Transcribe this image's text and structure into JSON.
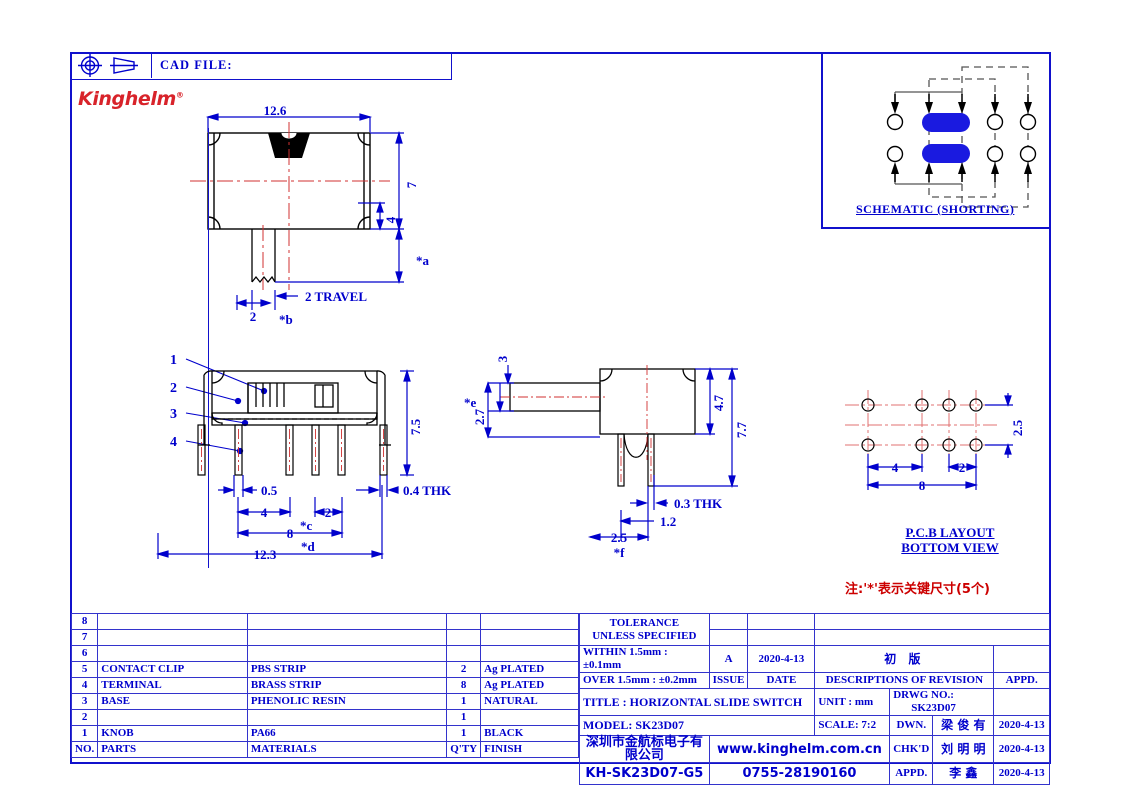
{
  "header": {
    "cad_file_label": "CAD FILE:",
    "brand": "Kinghelm",
    "brand_sup": "®"
  },
  "schematic": {
    "caption": "SCHEMATIC (SHORTING)"
  },
  "pcb": {
    "caption_line1": "P.C.B  LAYOUT",
    "caption_line2": "BOTTOM  VIEW",
    "dims": {
      "pitch_a": "4",
      "pitch_b": "2",
      "total": "8",
      "row_gap": "2.5"
    }
  },
  "note": "注:'*'表示关键尺寸(5个)",
  "views": {
    "top": {
      "width": "12.6",
      "height": "7",
      "knob_offset": "4",
      "travel": "2  TRAVEL",
      "travel_width": "2",
      "star_a": "*a",
      "star_b": "*b"
    },
    "front": {
      "callouts": [
        "1",
        "2",
        "3",
        "4"
      ],
      "height": "7.5",
      "thickness": "0.4  THK",
      "lead_gap": "0.5",
      "pitch_a": "4",
      "pitch_b": "2",
      "span8": "8",
      "span123": "12.3",
      "star_c": "*c",
      "star_d": "*d"
    },
    "side": {
      "knob_h": "3",
      "knob_y": "2.7",
      "body_h": "4.7",
      "total_h": "7.7",
      "pin_thk": "0.3  THK",
      "pin_w": "1.2",
      "pin_pitch": "2.5",
      "star_e": "*e",
      "star_f": "*f"
    }
  },
  "parts_table": {
    "columns": [
      "NO.",
      "PARTS",
      "MATERIALS",
      "Q'TY",
      "FINISH"
    ],
    "rows": [
      {
        "no": "8",
        "parts": "",
        "materials": "",
        "qty": "",
        "finish": ""
      },
      {
        "no": "7",
        "parts": "",
        "materials": "",
        "qty": "",
        "finish": ""
      },
      {
        "no": "6",
        "parts": "",
        "materials": "",
        "qty": "",
        "finish": ""
      },
      {
        "no": "5",
        "parts": "CONTACT CLIP",
        "materials": "PBS STRIP",
        "qty": "2",
        "finish": "Ag PLATED"
      },
      {
        "no": "4",
        "parts": "TERMINAL",
        "materials": "BRASS STRIP",
        "qty": "8",
        "finish": "Ag PLATED"
      },
      {
        "no": "3",
        "parts": "BASE",
        "materials": "PHENOLIC RESIN",
        "qty": "1",
        "finish": "NATURAL"
      },
      {
        "no": "2",
        "parts": "",
        "materials": "",
        "qty": "1",
        "finish": ""
      },
      {
        "no": "1",
        "parts": "KNOB",
        "materials": "PA66",
        "qty": "1",
        "finish": "BLACK"
      }
    ]
  },
  "title_block": {
    "tolerance_line1": "TOLERANCE",
    "tolerance_line2": "UNLESS   SPECIFIED",
    "tol_within": "WITHIN 1.5mm : ±0.1mm",
    "tol_over": "OVER 1.5mm : ±0.2mm",
    "issue_value": "A",
    "issue_label": "ISSUE",
    "date_value": "2020-4-13",
    "date_label": "DATE",
    "revision_value": "初 版",
    "revision_label": "DESCRIPTIONS OF REVISION",
    "appd_col_label": "APPD.",
    "title_label": "TITLE :   HORIZONTAL SLIDE SWITCH",
    "model_label": "MODEL:   SK23D07",
    "unit_label": "UNIT :    mm",
    "scale_label": "SCALE:   7:2",
    "drwg_no_label": "DRWG NO.:",
    "drwg_no_value": "SK23D07",
    "dwn_label": "DWN.",
    "dwn_name": "梁 俊 有",
    "dwn_date": "2020-4-13",
    "chkd_label": "CHK'D",
    "chkd_name": "刘 明 明",
    "chkd_date": "2020-4-13",
    "appd_label": "APPD.",
    "appd_name": "李 鑫",
    "appd_date": "2020-4-13",
    "company_cn": "深圳市金航标电子有限公司",
    "website": "www.kinghelm.com.cn",
    "part_number": "KH-SK23D07-G5",
    "phone": "0755-28190160"
  },
  "colors": {
    "line_blue": "#0000cc",
    "frame_blue": "#1111cc",
    "logo_red": "#d8232a",
    "center_red": "#d03030",
    "schematic_fill": "#1a1ae0",
    "note_red": "#cc0000"
  }
}
